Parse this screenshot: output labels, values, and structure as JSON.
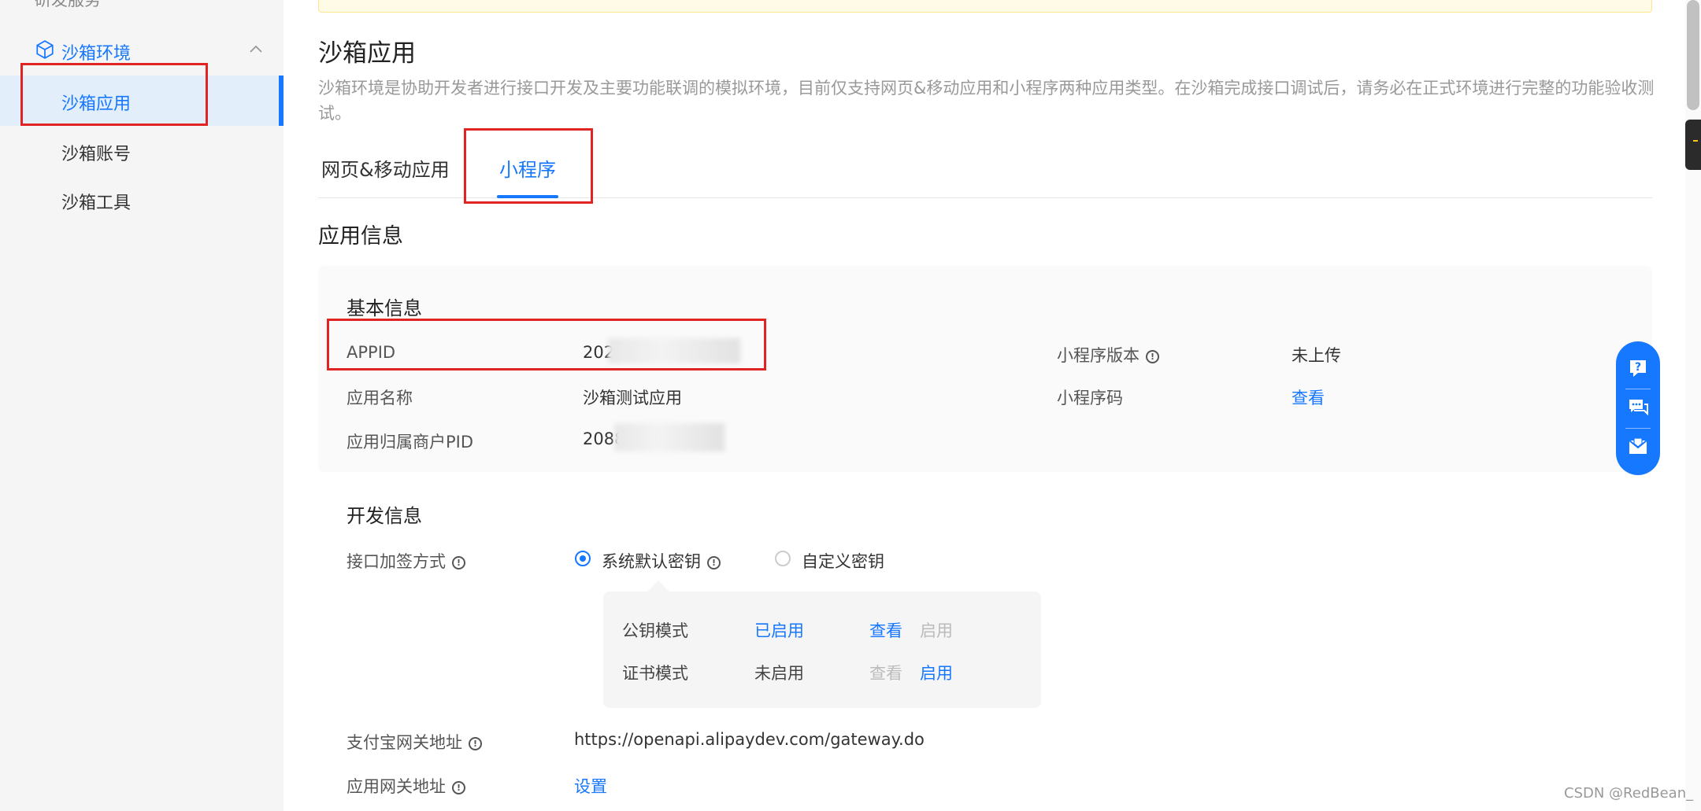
{
  "sidebar": {
    "top_item": "研发服务",
    "group": {
      "label": "沙箱环境",
      "icon": "cube-icon"
    },
    "items": [
      {
        "label": "沙箱应用",
        "active": true
      },
      {
        "label": "沙箱账号",
        "active": false
      },
      {
        "label": "沙箱工具",
        "active": false
      }
    ]
  },
  "main": {
    "title": "沙箱应用",
    "description": "沙箱环境是协助开发者进行接口开发及主要功能联调的模拟环境，目前仅支持网页&移动应用和小程序两种应用类型。在沙箱完成接口调试后，请务必在正式环境进行完整的功能验收测试。",
    "tabs": [
      {
        "label": "网页&移动应用",
        "active": false
      },
      {
        "label": "小程序",
        "active": true
      }
    ],
    "section_title": "应用信息",
    "basic_info": {
      "title": "基本信息",
      "appid_label": "APPID",
      "appid_value": "2021",
      "app_name_label": "应用名称",
      "app_name_value": "沙箱测试应用",
      "pid_label": "应用归属商户PID",
      "pid_value": "2088",
      "mini_version_label": "小程序版本",
      "mini_version_value": "未上传",
      "mini_code_label": "小程序码",
      "mini_code_value": "查看"
    },
    "dev_info": {
      "title": "开发信息",
      "sign_label": "接口加签方式",
      "sign_options": [
        {
          "label": "系统默认密钥",
          "selected": true
        },
        {
          "label": "自定义密钥",
          "selected": false
        }
      ],
      "modes": [
        {
          "name": "公钥模式",
          "status": "已启用",
          "view": "查看",
          "enable": "启用"
        },
        {
          "name": "证书模式",
          "status": "未启用",
          "view": "查看",
          "enable": "启用"
        }
      ],
      "gateway_label": "支付宝网关地址",
      "gateway_value": "https://openapi.alipaydev.com/gateway.do",
      "app_gateway_label": "应用网关地址",
      "app_gateway_value": "设置"
    }
  },
  "float_toolbar": [
    "help-icon",
    "chat-icon",
    "message-icon"
  ],
  "watermark": "CSDN @RedBean_",
  "colors": {
    "accent": "#1677ff",
    "highlight_box": "#e02424",
    "sidebar_bg": "#f5f5f6"
  }
}
